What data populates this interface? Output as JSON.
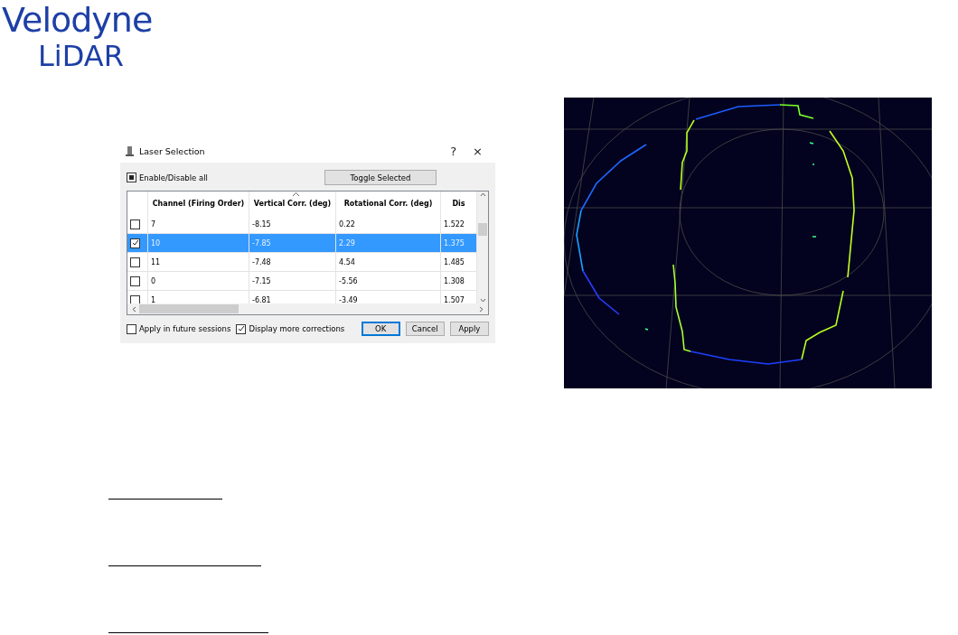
{
  "logo": {
    "line_1": "Velodyne",
    "line_2": "LiDAR"
  },
  "dialog": {
    "title": "Laser Selection",
    "help": "?",
    "close": "×",
    "enable_all": {
      "label": "Enable/Disable all",
      "indeterminate": true
    },
    "toggle_button": "Toggle Selected",
    "columns": [
      {
        "label": "Channel (Firing Order)",
        "sorted": false
      },
      {
        "label": "Vertical Corr. (deg)",
        "sorted": true
      },
      {
        "label": "Rotational Corr. (deg)",
        "sorted": false
      },
      {
        "label": "Dis",
        "sorted": false
      }
    ],
    "rows": [
      {
        "checked": false,
        "selected": false,
        "cells": [
          "7",
          "-8.15",
          "0.22",
          "1.522"
        ]
      },
      {
        "checked": true,
        "selected": true,
        "cells": [
          "10",
          "-7.85",
          "2.29",
          "1.375"
        ]
      },
      {
        "checked": false,
        "selected": false,
        "cells": [
          "11",
          "-7.48",
          "4.54",
          "1.485"
        ]
      },
      {
        "checked": false,
        "selected": false,
        "cells": [
          "0",
          "-7.15",
          "-5.56",
          "1.308"
        ]
      },
      {
        "checked": false,
        "selected": false,
        "cells": [
          "1",
          "-6.81",
          "-3.49",
          "1.507"
        ]
      }
    ],
    "options": [
      {
        "label": "Apply in future sessions",
        "checked": false
      },
      {
        "label": "Display more corrections",
        "checked": true
      }
    ],
    "buttons": [
      {
        "label": "OK",
        "default": true
      },
      {
        "label": "Cancel",
        "default": false
      },
      {
        "label": "Apply",
        "default": false
      }
    ]
  }
}
